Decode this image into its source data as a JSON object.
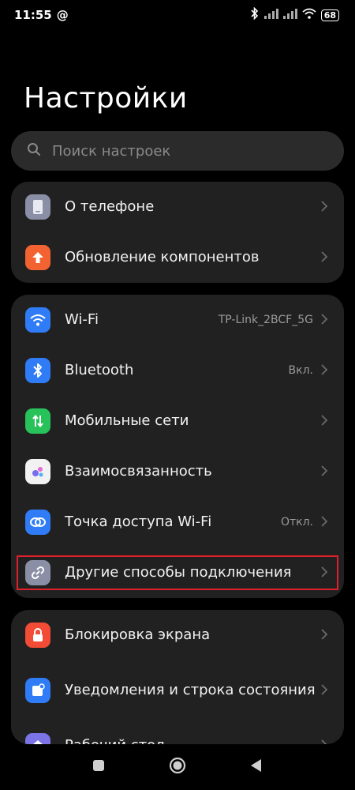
{
  "status_bar": {
    "time": "11:55",
    "at_symbol": "@",
    "battery": "68",
    "icons": [
      "bluetooth-icon",
      "signal-icon",
      "signal-icon",
      "wifi-icon",
      "battery-icon"
    ]
  },
  "page": {
    "title": "Настройки"
  },
  "search": {
    "placeholder": "Поиск настроек"
  },
  "groups": [
    {
      "items": [
        {
          "label": "О телефоне",
          "icon": "phone-icon",
          "icon_color": "#8a8fa6",
          "value": ""
        },
        {
          "label": "Обновление компонентов",
          "icon": "arrow-up-icon",
          "icon_color": "#f26331",
          "value": ""
        }
      ]
    },
    {
      "items": [
        {
          "label": "Wi-Fi",
          "icon": "wifi-icon",
          "icon_color": "#2f7cf6",
          "value": "TP-Link_2BCF_5G"
        },
        {
          "label": "Bluetooth",
          "icon": "bluetooth-icon",
          "icon_color": "#2f7cf6",
          "value": "Вкл."
        },
        {
          "label": "Мобильные сети",
          "icon": "mobile-data-icon",
          "icon_color": "#27c25a",
          "value": ""
        },
        {
          "label": "Взаимосвязанность",
          "icon": "interconnect-icon",
          "icon_color": "#f2f2f2",
          "value": ""
        },
        {
          "label": "Точка доступа Wi-Fi",
          "icon": "hotspot-icon",
          "icon_color": "#2f7cf6",
          "value": "Откл."
        },
        {
          "label": "Другие способы подключения",
          "icon": "link-icon",
          "icon_color": "#8a8fa6",
          "value": ""
        }
      ]
    },
    {
      "items": [
        {
          "label": "Блокировка экрана",
          "icon": "lock-icon",
          "icon_color": "#f24b36",
          "value": ""
        },
        {
          "label": "Уведомления и строка состояния",
          "icon": "notification-icon",
          "icon_color": "#2f7cf6",
          "value": ""
        },
        {
          "label": "Рабочий стол",
          "icon": "home-icon",
          "icon_color": "#7b73e6",
          "value": ""
        }
      ]
    }
  ],
  "highlight_color": "#e0202a",
  "nav_bar": {
    "buttons": [
      "recents-button",
      "home-button",
      "back-button"
    ]
  }
}
